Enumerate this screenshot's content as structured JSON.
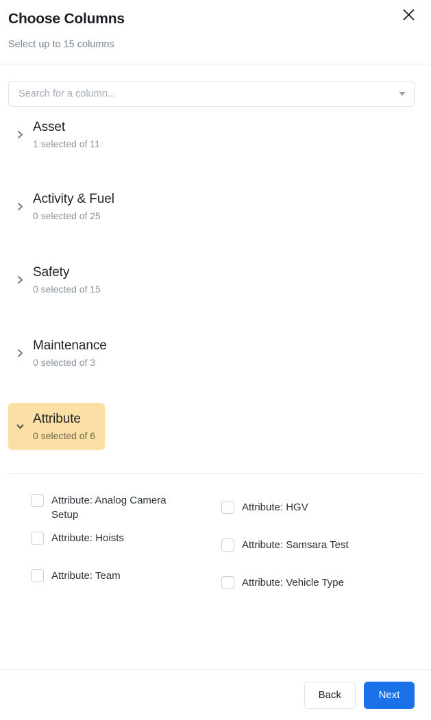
{
  "header": {
    "title": "Choose Columns",
    "subtitle": "Select up to 15 columns",
    "close_icon": "close-icon"
  },
  "search": {
    "placeholder": "Search for a column...",
    "value": "",
    "caret_icon": "chevron-down-icon"
  },
  "categories": [
    {
      "name": "Asset",
      "count": "1 selected of 11",
      "expanded": false,
      "chevron": "chevron-right-icon"
    },
    {
      "name": "Activity & Fuel",
      "count": "0 selected of 25",
      "expanded": false,
      "chevron": "chevron-right-icon"
    },
    {
      "name": "Safety",
      "count": "0 selected of 15",
      "expanded": false,
      "chevron": "chevron-right-icon"
    },
    {
      "name": "Maintenance",
      "count": "0 selected of 3",
      "expanded": false,
      "chevron": "chevron-right-icon"
    },
    {
      "name": "Attribute",
      "count": "0 selected of 6",
      "expanded": true,
      "chevron": "chevron-down-icon"
    }
  ],
  "options": {
    "left": [
      {
        "label": "Attribute: Analog Camera Setup",
        "checked": false
      },
      {
        "label": "Attribute: Hoists",
        "checked": false
      },
      {
        "label": "Attribute: Team",
        "checked": false
      }
    ],
    "right": [
      {
        "label": "Attribute: HGV",
        "checked": false
      },
      {
        "label": "Attribute: Samsara Test",
        "checked": false
      },
      {
        "label": "Attribute: Vehicle Type",
        "checked": false
      }
    ]
  },
  "footer": {
    "back_label": "Back",
    "next_label": "Next"
  },
  "colors": {
    "highlight": "#fbdfa5",
    "primary": "#1b72e8",
    "divider": "#e8eaed",
    "muted_text": "#8b949f"
  }
}
